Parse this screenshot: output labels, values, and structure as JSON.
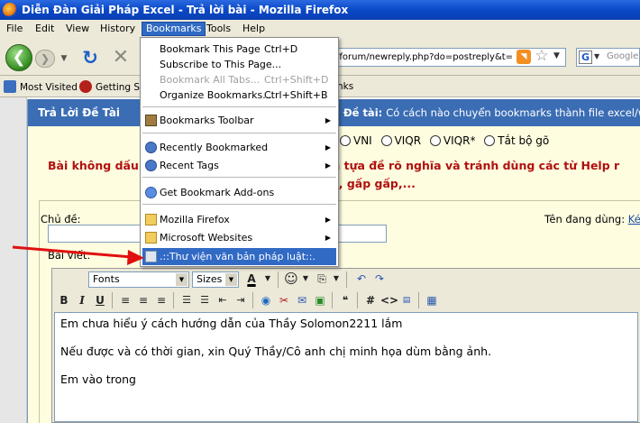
{
  "window": {
    "title": "Diễn Đàn Giải Pháp Excel - Trả lời bài - Mozilla Firefox"
  },
  "menubar": {
    "items": [
      "File",
      "Edit",
      "View",
      "History",
      "Bookmarks",
      "Tools",
      "Help"
    ],
    "active": "Bookmarks"
  },
  "navbar": {
    "url": "/forum/newreply.php?do=postreply&t=",
    "search_placeholder": "Google"
  },
  "bookmarks_toolbar": {
    "items": [
      "Most Visited",
      "Getting St",
      "nks"
    ]
  },
  "bookmarks_menu": {
    "items": [
      {
        "label": "Bookmark This Page",
        "shortcut": "Ctrl+D"
      },
      {
        "label": "Subscribe to This Page...",
        "shortcut": ""
      },
      {
        "label": "Bookmark All Tabs...",
        "shortcut": "Ctrl+Shift+D",
        "disabled": true
      },
      {
        "label": "Organize Bookmarks...",
        "shortcut": "Ctrl+Shift+B"
      },
      {
        "label": "Bookmarks Toolbar",
        "submenu": true,
        "icon": "bookmarks-toolbar-icon"
      },
      {
        "label": "Recently Bookmarked",
        "submenu": true,
        "icon": "clock-icon"
      },
      {
        "label": "Recent Tags",
        "submenu": true,
        "icon": "clock-icon"
      },
      {
        "label": "Get Bookmark Add-ons",
        "icon": "addon-icon"
      },
      {
        "label": "Mozilla Firefox",
        "submenu": true,
        "icon": "folder-icon"
      },
      {
        "label": "Microsoft Websites",
        "submenu": true,
        "icon": "folder-icon"
      },
      {
        "label": ".::Thư viện văn bản pháp luật::.",
        "icon": "page-icon",
        "highlighted": true
      }
    ]
  },
  "forum": {
    "header_title": "Trả Lời Đề Tài",
    "header_topic_label": "Đề tài:",
    "header_topic_text": "Có cách nào chuyển bookmarks thành file excel/wo",
    "ime_options": [
      "VNI",
      "VIQR",
      "VIQR*",
      "Tắt bộ gõ"
    ],
    "warning_line1": "Bài không dấu",
    "warning_line1b": "tên tựa đề rõ nghĩa và tránh dùng các từ Help r",
    "warning_line2": "u em, gấp gấp,...",
    "subject_label": "Chủ đề:",
    "username_label": "Tên đang dùng:",
    "username_link": "Ké",
    "body_label": "Bài viết:"
  },
  "editor": {
    "font_select": "Fonts",
    "size_select": "Sizes",
    "text_color_icon": "A",
    "lines": [
      "Em chưa hiểu ý cách hướng dẫn của Thầy Solomon2211 lắm",
      "Nếu được và có thời gian, xin Quý Thầy/Cô anh chị minh họa dùm bằng ảnh.",
      "Em vào trong"
    ]
  },
  "colors": {
    "accent": "#316ac5",
    "titlebar": "#0a48c8",
    "warning": "#b01010",
    "arrow": "#e01010"
  }
}
